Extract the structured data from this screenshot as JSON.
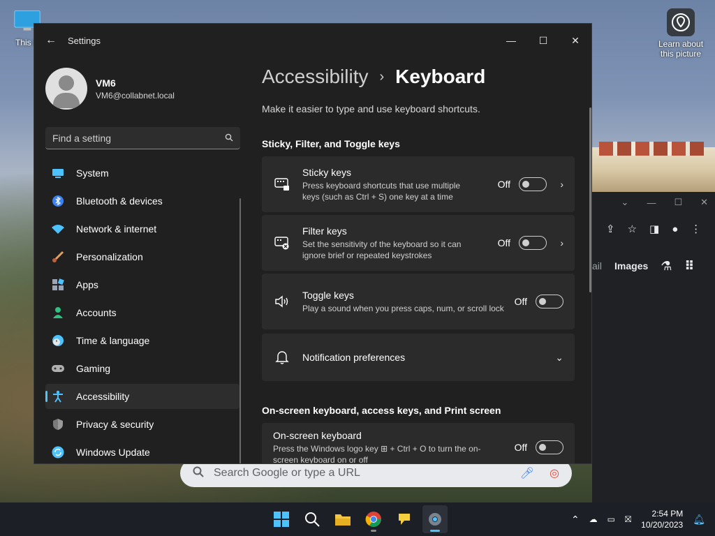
{
  "desktop": {
    "icon_this_pc_label": "This P",
    "learn_picture_label": "Learn about this picture"
  },
  "chrome_bg": {
    "link_images": "Images",
    "link_partial": "ail",
    "search_placeholder": "Search Google or type a URL"
  },
  "window": {
    "title": "Settings",
    "back_icon": "back-arrow-icon"
  },
  "profile": {
    "name": "VM6",
    "email": "VM6@collabnet.local"
  },
  "search": {
    "placeholder": "Find a setting"
  },
  "nav": {
    "items": [
      {
        "label": "System",
        "icon": "system-icon",
        "color": "#4cc2ff"
      },
      {
        "label": "Bluetooth & devices",
        "icon": "bluetooth-icon",
        "color": "#3b82f6"
      },
      {
        "label": "Network & internet",
        "icon": "wifi-icon",
        "color": "#4cc2ff"
      },
      {
        "label": "Personalization",
        "icon": "paintbrush-icon",
        "color": "#e0a060"
      },
      {
        "label": "Apps",
        "icon": "apps-icon",
        "color": "#9aa6b8"
      },
      {
        "label": "Accounts",
        "icon": "accounts-icon",
        "color": "#2ec27e"
      },
      {
        "label": "Time & language",
        "icon": "clock-globe-icon",
        "color": "#4cc2ff"
      },
      {
        "label": "Gaming",
        "icon": "gamepad-icon",
        "color": "#b0b0b0"
      },
      {
        "label": "Accessibility",
        "icon": "accessibility-icon",
        "color": "#4cc2ff"
      },
      {
        "label": "Privacy & security",
        "icon": "shield-icon",
        "color": "#9a9a9a"
      },
      {
        "label": "Windows Update",
        "icon": "update-icon",
        "color": "#4cc2ff"
      }
    ],
    "active_index": 8
  },
  "page": {
    "breadcrumb_parent": "Accessibility",
    "breadcrumb_current": "Keyboard",
    "description": "Make it easier to type and use keyboard shortcuts.",
    "section1": "Sticky, Filter, and Toggle keys",
    "section2": "On-screen keyboard, access keys, and Print screen",
    "cards": {
      "sticky": {
        "title": "Sticky keys",
        "desc": "Press keyboard shortcuts that use multiple keys (such as Ctrl + S) one key at a time",
        "state": "Off"
      },
      "filter": {
        "title": "Filter keys",
        "desc": "Set the sensitivity of the keyboard so it can ignore brief or repeated keystrokes",
        "state": "Off"
      },
      "toggle": {
        "title": "Toggle keys",
        "desc": "Play a sound when you press caps, num, or scroll lock",
        "state": "Off"
      },
      "notifications": {
        "title": "Notification preferences"
      },
      "osk": {
        "title": "On-screen keyboard",
        "desc": "Press the Windows logo key ⊞ + Ctrl + O to turn the on-screen keyboard on or off",
        "state": "Off"
      }
    }
  },
  "taskbar": {
    "time": "2:54 PM",
    "date": "10/20/2023"
  },
  "colors": {
    "accent": "#4cc2ff",
    "window_bg": "#202020",
    "card_bg": "#2b2b2b"
  }
}
